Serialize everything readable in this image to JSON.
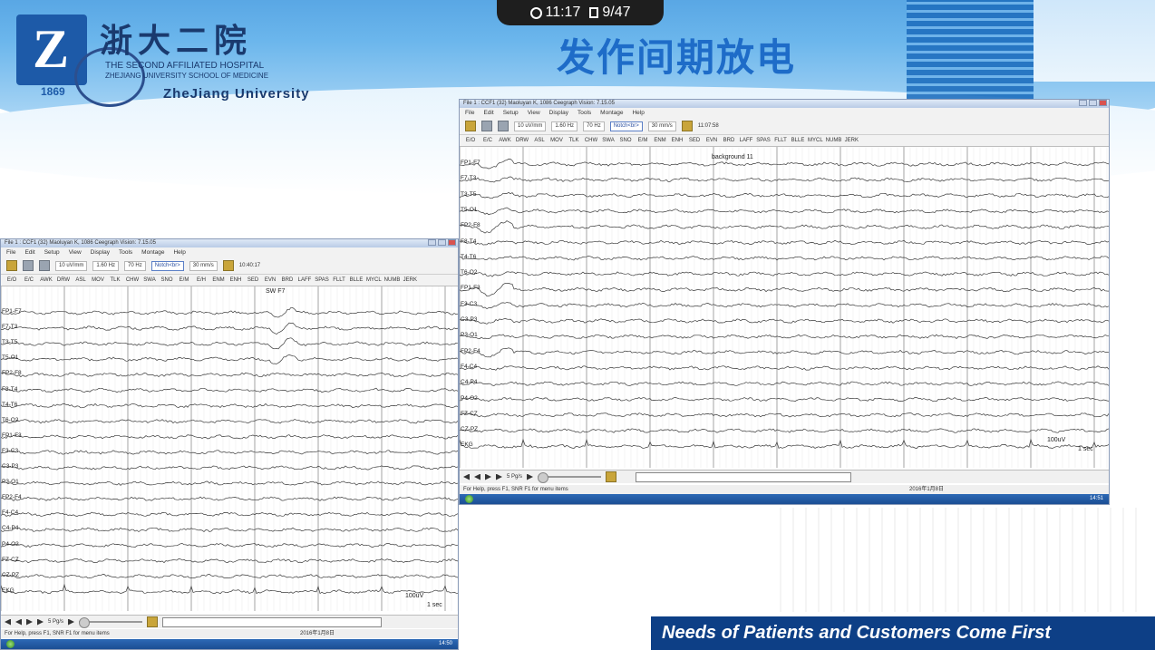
{
  "slide": {
    "timer": {
      "time": "11:17",
      "page": "9/47"
    },
    "logo": {
      "letter": "Z",
      "year": "1869"
    },
    "university": {
      "name_cn": "浙大二院",
      "hospital_en": "THE SECOND AFFILIATED HOSPITAL",
      "school_en": "ZHEJIANG UNIVERSITY SCHOOL OF MEDICINE",
      "name_en": "ZheJiang University"
    },
    "title": "发作间期放电",
    "footer": "Needs of Patients and Customers Come First"
  },
  "eeg_windows": [
    {
      "title": "File 1 : CCF1 (32)      Maoluyan K, 1086      Ceegraph Vision: 7.15.05",
      "menu": [
        "File",
        "Edit",
        "Setup",
        "View",
        "Display",
        "Tools",
        "Montage",
        "Help"
      ],
      "toolbar": {
        "sensitivity": "10 uV/mm",
        "low_filter": "1.60 Hz",
        "high_filter": "70 Hz",
        "notch": "Notch<br>",
        "speed": "30 mm/s",
        "clock": "10:40:17"
      },
      "events": [
        "E/O",
        "E/C",
        "AWK",
        "DRW",
        "ASL",
        "MOV",
        "TLK",
        "CHW",
        "SWA",
        "SNO",
        "E/M",
        "E/H",
        "ENM",
        "ENH",
        "SED",
        "EVN",
        "BRD",
        "LAFF",
        "SPAS",
        "FLLT",
        "BLLE",
        "MYCL",
        "NUMB",
        "JERK"
      ],
      "annotation": "SW F7",
      "channels": [
        "FP1-F7",
        "F7-T3",
        "T3-T5",
        "T5-O1",
        "FP2-F8",
        "F8-T4",
        "T4-T6",
        "T6-O2",
        "FP1-F3",
        "F3-C3",
        "C3-P3",
        "P3-O1",
        "FP2-F4",
        "F4-C4",
        "C4-P4",
        "P4-O2",
        "FZ-CZ",
        "CZ-PZ",
        "EKG"
      ],
      "scale": "100uV",
      "scale_time": "1 sec",
      "page_speed": "5 Pg/s",
      "status": "For Help, press F1, SNR F1 for menu items",
      "date": "2016年1月8日",
      "taskbar_time": "14:50"
    },
    {
      "title": "File 1 : CCF1 (32)      Maoluyan K, 1086      Ceegraph Vision: 7.15.05",
      "menu": [
        "File",
        "Edit",
        "Setup",
        "View",
        "Display",
        "Tools",
        "Montage",
        "Help"
      ],
      "toolbar": {
        "sensitivity": "10 uV/mm",
        "low_filter": "1.60 Hz",
        "high_filter": "70 Hz",
        "notch": "Notch<br>",
        "speed": "30 mm/s",
        "clock": "11:07:58"
      },
      "events": [
        "E/O",
        "E/C",
        "AWK",
        "DRW",
        "ASL",
        "MOV",
        "TLK",
        "CHW",
        "SWA",
        "SNO",
        "E/M",
        "ENM",
        "ENH",
        "SED",
        "EVN",
        "BRD",
        "LAFF",
        "SPAS",
        "FLLT",
        "BLLE",
        "MYCL",
        "NUMB",
        "JERK"
      ],
      "annotation": "background 11",
      "channels": [
        "FP1-F7",
        "F7-T3",
        "T3-T5",
        "T5-O1",
        "FP2-F8",
        "F8-T4",
        "T4-T6",
        "T6-O2",
        "FP1-F3",
        "F3-C3",
        "C3-P3",
        "P3-O1",
        "FP2-F4",
        "F4-C4",
        "C4-P4",
        "P4-O2",
        "FZ-CZ",
        "CZ-PZ",
        "EKG"
      ],
      "scale": "100uV",
      "scale_time": "1 sec",
      "page_speed": "5 Pg/s",
      "status": "For Help, press F1, SNR F1 for menu items",
      "date": "2016年1月8日",
      "taskbar_time": "14:51"
    }
  ],
  "colors": {
    "title_blue": "#1e6cc8",
    "banner_navy": "#0d3f86",
    "trace": "#3a3a3a",
    "grid": "#d9d9d9"
  }
}
